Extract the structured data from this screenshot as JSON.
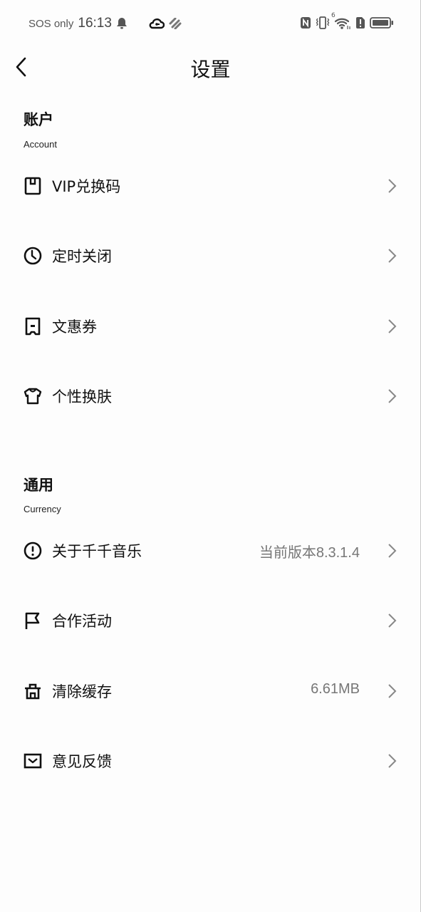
{
  "status_bar": {
    "carrier": "SOS only",
    "time": "16:13",
    "wifi_label": "6",
    "icons_left": [
      "bell-icon",
      "cloud-icon",
      "heart-icon"
    ],
    "icons_right": [
      "nfc-icon",
      "vibrate-icon",
      "wifi-icon",
      "sim-alert-icon",
      "battery-icon"
    ]
  },
  "header": {
    "title": "设置",
    "back_icon": "chevron-left-icon"
  },
  "sections": [
    {
      "title": "账户",
      "subtitle": "Account",
      "items": [
        {
          "label": "VIP兑换码",
          "icon": "bookmark-icon",
          "value": ""
        },
        {
          "label": "定时关闭",
          "icon": "clock-icon",
          "value": ""
        },
        {
          "label": "文惠券",
          "icon": "ticket-icon",
          "value": ""
        },
        {
          "label": "个性换肤",
          "icon": "shirt-icon",
          "value": ""
        }
      ]
    },
    {
      "title": "通用",
      "subtitle": "Currency",
      "items": [
        {
          "label": "关于千千音乐",
          "icon": "info-icon",
          "value": "当前版本8.3.1.4"
        },
        {
          "label": "合作活动",
          "icon": "flag-icon",
          "value": ""
        },
        {
          "label": "清除缓存",
          "icon": "trash-icon",
          "value": "6.61MB"
        },
        {
          "label": "意见反馈",
          "icon": "mail-icon",
          "value": ""
        }
      ]
    }
  ]
}
